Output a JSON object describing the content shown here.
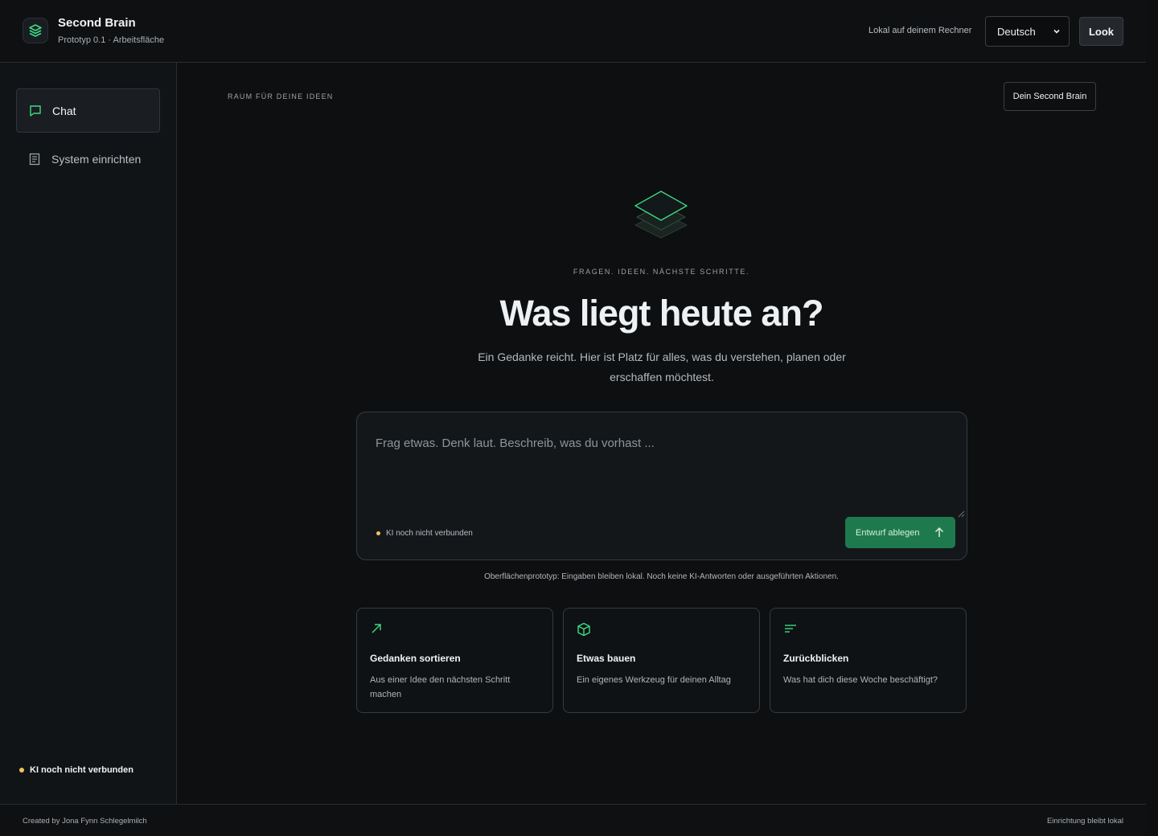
{
  "app": {
    "title": "Second Brain",
    "subtitle": "Prototyp 0.1 · Arbeitsfläche",
    "logo_icon": "layers-icon"
  },
  "header": {
    "local_label": "Lokal auf deinem Rechner",
    "language_selected": "Deutsch",
    "look_label": "Look"
  },
  "sidebar": {
    "items": [
      {
        "label": "Chat",
        "icon": "chat-bubble-icon",
        "active": true
      },
      {
        "label": "System einrichten",
        "icon": "document-icon",
        "active": false
      }
    ],
    "status": "KI noch nicht verbunden"
  },
  "main": {
    "eyebrow": "RAUM FÜR DEINE IDEEN",
    "second_brain_button": "Dein Second Brain",
    "hero_eyebrow": "FRAGEN. IDEEN. NÄCHSTE SCHRITTE.",
    "hero_title": "Was liegt heute an?",
    "hero_subtitle": "Ein Gedanke reicht. Hier ist Platz für alles, was du verstehen, planen oder erschaffen möchtest.",
    "composer": {
      "placeholder": "Frag etwas. Denk laut. Beschreib, was du vorhast ...",
      "status": "KI noch nicht verbunden",
      "submit_label": "Entwurf ablegen"
    },
    "disclaimer": "Oberflächenprototyp: Eingaben bleiben lokal. Noch keine KI-Antworten oder ausgeführten Aktionen.",
    "cards": [
      {
        "title": "Gedanken sortieren",
        "desc": "Aus einer Idee den nächsten Schritt machen",
        "icon": "arrow-up-right-icon"
      },
      {
        "title": "Etwas bauen",
        "desc": "Ein eigenes Werkzeug für deinen Alltag",
        "icon": "cube-icon"
      },
      {
        "title": "Zurückblicken",
        "desc": "Was hat dich diese Woche beschäftigt?",
        "icon": "lines-icon"
      }
    ]
  },
  "footer": {
    "left": "Created by Jona Fynn Schlegelmilch",
    "right": "Einrichtung bleibt lokal"
  },
  "colors": {
    "accent": "#3ddc84",
    "button_green": "#1e7a4c",
    "status_dot": "#f2c25a",
    "background": "#0d0f11"
  }
}
